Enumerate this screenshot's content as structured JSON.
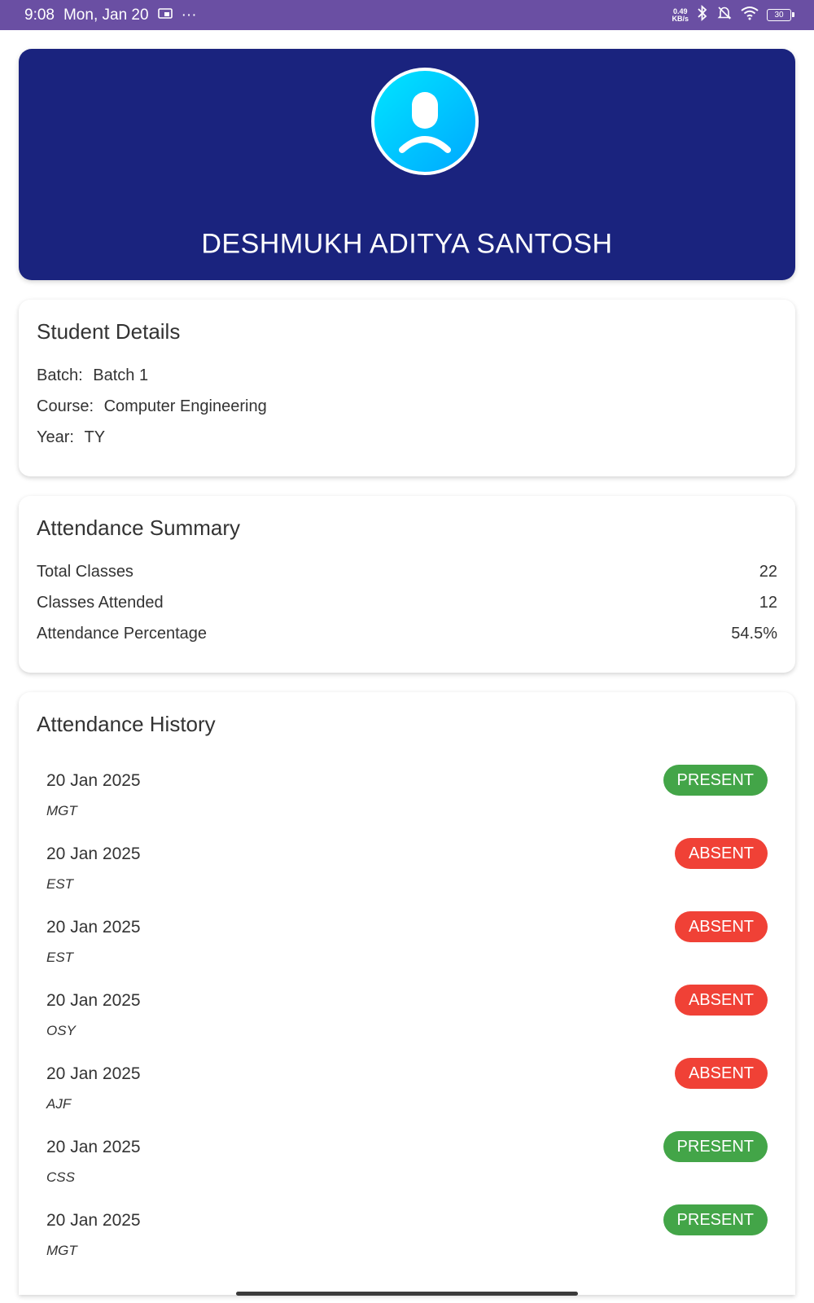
{
  "colors": {
    "status_bar": "#6a4fa3",
    "header_bg": "#1a237e",
    "avatar_bg": "#00c8ff",
    "present": "#43a548",
    "absent": "#f04136"
  },
  "status_bar": {
    "time": "9:08",
    "date": "Mon, Jan 20",
    "overflow": "···",
    "speed_value": "0.49",
    "speed_unit": "KB/s",
    "battery": "30",
    "icons": [
      "cast-icon",
      "bluetooth-icon",
      "bell-off-icon",
      "wifi-icon",
      "battery-icon"
    ]
  },
  "header": {
    "avatar_icon": "person-icon",
    "student_name": "DESHMUKH ADITYA SANTOSH"
  },
  "student_details": {
    "title": "Student Details",
    "batch_label": "Batch:",
    "batch_value": "Batch 1",
    "course_label": "Course:",
    "course_value": "Computer Engineering",
    "year_label": "Year:",
    "year_value": "TY"
  },
  "attendance_summary": {
    "title": "Attendance Summary",
    "rows": [
      {
        "label": "Total Classes",
        "value": "22"
      },
      {
        "label": "Classes Attended",
        "value": "12"
      },
      {
        "label": "Attendance Percentage",
        "value": "54.5%"
      }
    ]
  },
  "attendance_history": {
    "title": "Attendance History",
    "entries": [
      {
        "date": "20 Jan 2025",
        "subject": "MGT",
        "status": "PRESENT"
      },
      {
        "date": "20 Jan 2025",
        "subject": "EST",
        "status": "ABSENT"
      },
      {
        "date": "20 Jan 2025",
        "subject": "EST",
        "status": "ABSENT"
      },
      {
        "date": "20 Jan 2025",
        "subject": "OSY",
        "status": "ABSENT"
      },
      {
        "date": "20 Jan 2025",
        "subject": "AJF",
        "status": "ABSENT"
      },
      {
        "date": "20 Jan 2025",
        "subject": "CSS",
        "status": "PRESENT"
      },
      {
        "date": "20 Jan 2025",
        "subject": "MGT",
        "status": "PRESENT"
      }
    ]
  }
}
